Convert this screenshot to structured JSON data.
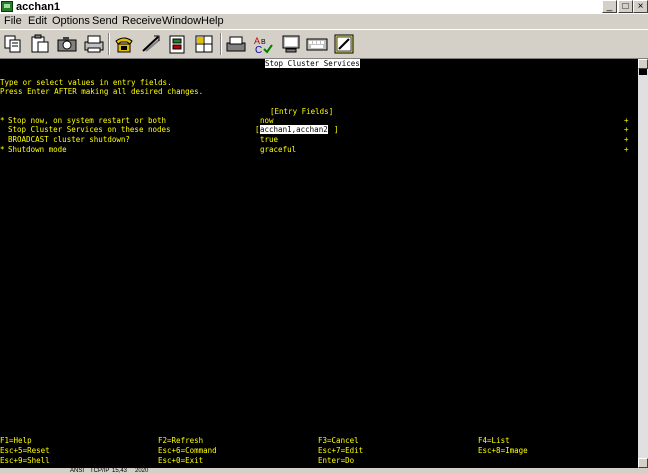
{
  "window": {
    "title": "acchan1"
  },
  "menu": [
    "File",
    "Edit",
    "Options",
    "Send",
    "Receive",
    "Window",
    "Help"
  ],
  "toolbar_icons": [
    "copy-icon",
    "paste-icon",
    "camera-icon",
    "print-icon",
    "phone-icon",
    "transfer-icon",
    "clipboard-icon",
    "grid-icon",
    "print-screen-icon",
    "spell-check-icon",
    "monitor-icon",
    "keyboard-icon",
    "edit-image-icon"
  ],
  "terminal": {
    "header": "Stop Cluster Services",
    "instructions": [
      "Type or select values in entry fields.",
      "Press Enter AFTER making all desired changes."
    ],
    "entry_header": "[Entry Fields]",
    "fields": [
      {
        "marker": "*",
        "label": "Stop now, on system restart or both",
        "value": "now",
        "plus": "+"
      },
      {
        "marker": " ",
        "label": "Stop Cluster Services on these nodes",
        "value": "acchan1,acchan2",
        "plus": "+"
      },
      {
        "marker": " ",
        "label": "BROADCAST cluster shutdown?",
        "value": "true",
        "plus": "+"
      },
      {
        "marker": "*",
        "label": "Shutdown mode",
        "value": "graceful",
        "plus": "+"
      }
    ],
    "fkeys": [
      [
        "F1=Help",
        "F2=Refresh",
        "F3=Cancel",
        "F4=List"
      ],
      [
        "Esc+5=Reset",
        "Esc+6=Command",
        "Esc+7=Edit",
        "Esc+8=Image"
      ],
      [
        "Esc+9=Shell",
        "Esc+0=Exit",
        "Enter=Do",
        ""
      ]
    ]
  },
  "status": {
    "mode": "ANSI",
    "protocol": "TCP/IP",
    "position": "15,43",
    "code": "2020"
  }
}
